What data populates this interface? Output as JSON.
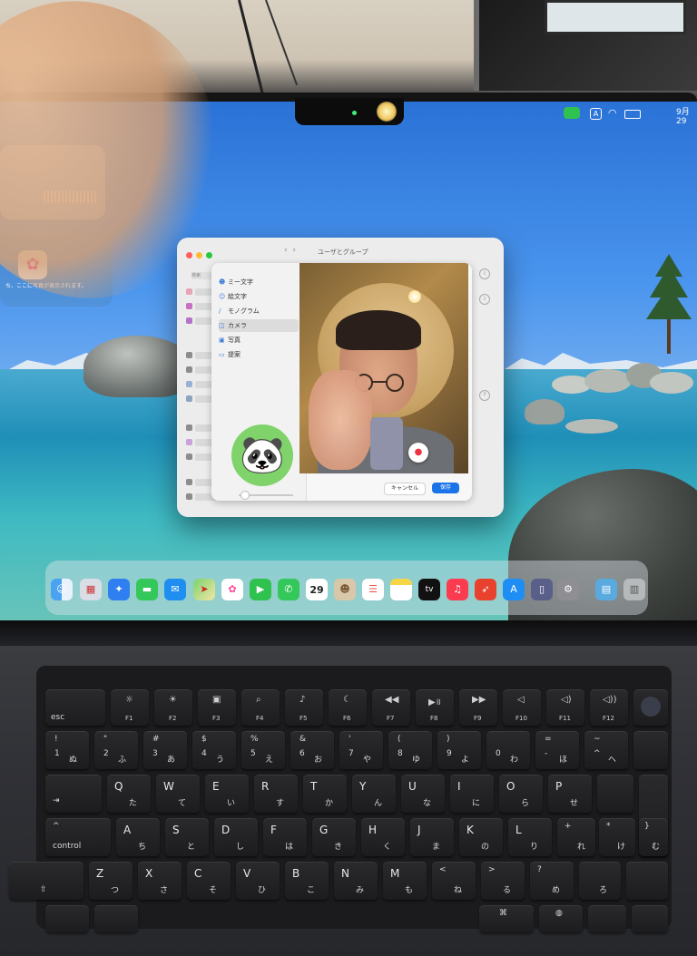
{
  "menubar": {
    "time": "9月29"
  },
  "window": {
    "title": "ユーザとグループ",
    "sidebar_search": "検索",
    "list": [
      {
        "icon": "memoji-icon",
        "label": "ミー文字"
      },
      {
        "icon": "emoji-icon",
        "label": "絵文字"
      },
      {
        "icon": "monogram-icon",
        "label": "モノグラム"
      },
      {
        "icon": "camera-icon",
        "label": "カメラ"
      },
      {
        "icon": "photos-icon",
        "label": "写真"
      },
      {
        "icon": "suggestions-icon",
        "label": "提案"
      }
    ],
    "selected_item": "カメラ",
    "cancel_label": "キャンセル",
    "save_label": "保存"
  },
  "widget": {
    "text": "ち、ここに写真が表示されます。"
  },
  "dock": {
    "calendar_day": "29",
    "tv_label": "tv",
    "items": [
      "finder-icon",
      "launchpad-icon",
      "safari-icon",
      "messages-icon",
      "mail-icon",
      "maps-icon",
      "photos-icon",
      "facetime-icon",
      "phone-icon",
      "calendar-icon",
      "contacts-icon",
      "reminders-icon",
      "notes-icon",
      "tv-icon",
      "music-icon",
      "rocket-icon",
      "app-store-icon",
      "iphone-mirroring-icon",
      "settings-icon",
      "downloads-folder-icon",
      "trash-icon"
    ]
  },
  "keyboard": {
    "esc": "esc",
    "control": "control",
    "fkeys": [
      "F1",
      "F2",
      "F3",
      "F4",
      "F5",
      "F6",
      "F7",
      "F8",
      "F9",
      "F10",
      "F11",
      "F12"
    ],
    "row1": [
      {
        "main": "!",
        "sub": "1",
        "kana": "ぬ"
      },
      {
        "main": "\"",
        "sub": "2",
        "kana": "ふ"
      },
      {
        "main": "#",
        "sub": "3",
        "kana": "あ"
      },
      {
        "main": "$",
        "sub": "4",
        "kana": "う"
      },
      {
        "main": "%",
        "sub": "5",
        "kana": "え"
      },
      {
        "main": "&",
        "sub": "6",
        "kana": "お"
      },
      {
        "main": "'",
        "sub": "7",
        "kana": "や"
      },
      {
        "main": "(",
        "sub": "8",
        "kana": "ゆ"
      },
      {
        "main": ")",
        "sub": "9",
        "kana": "よ"
      },
      {
        "main": "",
        "sub": "0",
        "kana": "わ"
      },
      {
        "main": "=",
        "sub": "-",
        "kana": "ほ"
      },
      {
        "main": "~",
        "sub": "^",
        "kana": "へ"
      }
    ],
    "row2": [
      {
        "main": "Q",
        "kana": "た"
      },
      {
        "main": "W",
        "kana": "て"
      },
      {
        "main": "E",
        "kana": "い"
      },
      {
        "main": "R",
        "kana": "す"
      },
      {
        "main": "T",
        "kana": "か"
      },
      {
        "main": "Y",
        "kana": "ん"
      },
      {
        "main": "U",
        "kana": "な"
      },
      {
        "main": "I",
        "kana": "に"
      },
      {
        "main": "O",
        "kana": "ら"
      },
      {
        "main": "P",
        "kana": "せ"
      }
    ],
    "row3": [
      {
        "main": "A",
        "kana": "ち"
      },
      {
        "main": "S",
        "kana": "と"
      },
      {
        "main": "D",
        "kana": "し"
      },
      {
        "main": "F",
        "kana": "は"
      },
      {
        "main": "G",
        "kana": "き"
      },
      {
        "main": "H",
        "kana": "く"
      },
      {
        "main": "J",
        "kana": "ま"
      },
      {
        "main": "K",
        "kana": "の"
      },
      {
        "main": "L",
        "kana": "り"
      },
      {
        "main": "+",
        "kana": "れ"
      },
      {
        "main": "*",
        "kana": "け"
      },
      {
        "main": "}",
        "kana": "む"
      }
    ],
    "row4": [
      {
        "main": "Z",
        "kana": "つ"
      },
      {
        "main": "X",
        "kana": "さ"
      },
      {
        "main": "C",
        "kana": "そ"
      },
      {
        "main": "V",
        "kana": "ひ"
      },
      {
        "main": "B",
        "kana": "こ"
      },
      {
        "main": "N",
        "kana": "み"
      },
      {
        "main": "M",
        "kana": "も"
      },
      {
        "main": "<",
        "kana": "ね"
      },
      {
        "main": ">",
        "kana": "る"
      },
      {
        "main": "?",
        "kana": "め"
      },
      {
        "main": "",
        "kana": "ろ"
      }
    ]
  }
}
